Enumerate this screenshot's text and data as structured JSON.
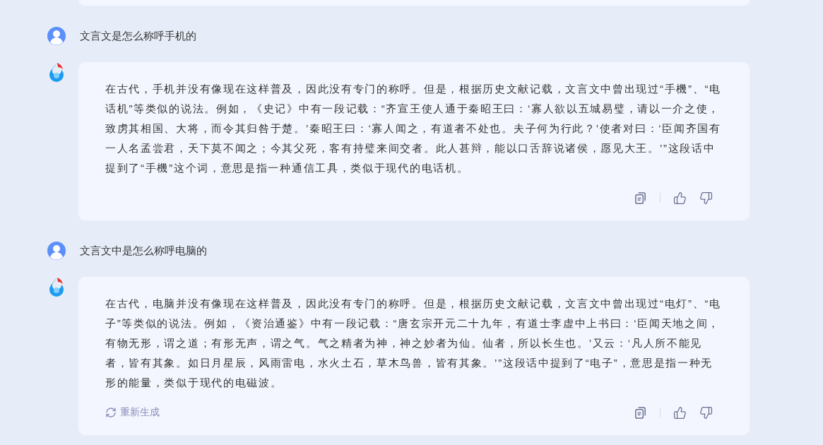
{
  "messages": [
    {
      "kind": "user",
      "text": "文言文是怎么称呼手机的"
    },
    {
      "kind": "bot",
      "text": "在古代，手机并没有像现在这样普及，因此没有专门的称呼。但是，根据历史文献记载，文言文中曾出现过“手機”、“电话机”等类似的说法。例如，《史记》中有一段记载：“齐宣王使人通于秦昭王曰：‘寡人欲以五城易璧，请以一介之使，致虏其相国、大将，而令其归咎于楚。’秦昭王曰：‘寡人闻之，有道者不处也。夫子何为行此？’使者对曰：‘臣闻齐国有一人名孟尝君，天下莫不闻之；今其父死，客有持璧来间交者。此人甚辩，能以口舌辞说诸侯，愿见大王。’”这段话中提到了“手機”这个词，意思是指一种通信工具，类似于现代的电话机。"
    },
    {
      "kind": "user",
      "text": "文言文中是怎么称呼电脑的"
    },
    {
      "kind": "bot",
      "text": "在古代，电脑并没有像现在这样普及，因此没有专门的称呼。但是，根据历史文献记载，文言文中曾出现过“电灯”、“电子”等类似的说法。例如，《资治通鉴》中有一段记载：“唐玄宗开元二十九年，有道士李虚中上书曰：‘臣闻天地之间，有物无形，谓之道；有形无声，谓之气。气之精者为神，神之妙者为仙。仙者，所以长生也。’又云：‘凡人所不能见者，皆有其象。如日月星辰，风雨雷电，水火土石，草木鸟兽，皆有其象。’”这段话中提到了“电子”，意思是指一种无形的能量，类似于现代的电磁波。",
      "regenerate": "重新生成"
    }
  ]
}
